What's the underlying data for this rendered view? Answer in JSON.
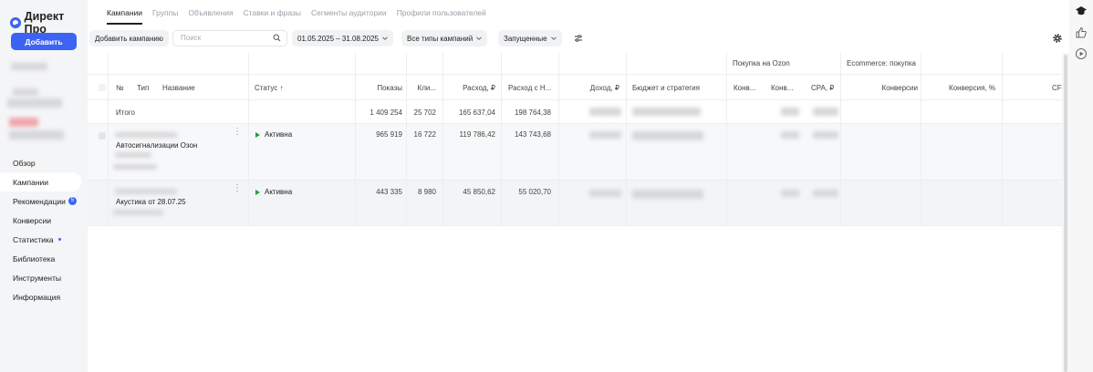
{
  "app": {
    "logo_text": "Директ Про",
    "add_button": "Добавить"
  },
  "sidebar": {
    "items": [
      {
        "label": "Обзор",
        "active": false
      },
      {
        "label": "Кампании",
        "active": true
      },
      {
        "label": "Рекомендации",
        "badge": "5"
      },
      {
        "label": "Конверсии"
      },
      {
        "label": "Статистика",
        "dot": true
      },
      {
        "label": "Библиотека"
      },
      {
        "label": "Инструменты"
      },
      {
        "label": "Информация"
      }
    ]
  },
  "tabs": [
    "Кампании",
    "Группы",
    "Объявления",
    "Ставки и фразы",
    "Сегменты аудитории",
    "Профили пользователей"
  ],
  "toolbar": {
    "add_campaign": "Добавить кампанию",
    "search_placeholder": "Поиск",
    "date_range": "01.05.2025 – 31.08.2025",
    "campaign_types": "Все типы кампаний",
    "state_filter": "Запущенные"
  },
  "table": {
    "group_headers": {
      "ozon": "Покупка на Ozon",
      "ecommerce": "Ecommerce: покупка"
    },
    "columns": {
      "num": "№",
      "type": "Тип",
      "name": "Название",
      "status": "Статус ↑",
      "impressions": "Показы",
      "clicks": "Кли...",
      "spend": "Расход, ₽",
      "spend_vat": "Расход с Н...",
      "income": "Доход, ₽",
      "budget": "Бюджет и стратегия",
      "ozon_conv": "Конв...",
      "ozon_conv2": "Конв...",
      "ozon_cpa": "CPA, ₽",
      "ecom_conv": "Конверсии",
      "ecom_conv_rate": "Конверсия, %",
      "ecom_cp": "CF"
    },
    "total": {
      "label": "Итого",
      "impressions": "1 409 254",
      "clicks": "25 702",
      "spend": "165 637,04",
      "spend_vat": "198 764,38"
    },
    "rows": [
      {
        "name": "Автосигнализации Озон",
        "status": "Активна",
        "impressions": "965 919",
        "clicks": "16 722",
        "spend": "119 786,42",
        "spend_vat": "143 743,68"
      },
      {
        "name": "Акустика от 28.07.25",
        "status": "Активна",
        "impressions": "443 335",
        "clicks": "8 980",
        "spend": "45 850,62",
        "spend_vat": "55 020,70"
      }
    ]
  },
  "icons": {
    "logo": "direct-logo-icon",
    "search": "search-icon",
    "chevron": "chevron-down-icon",
    "filters": "filter-sliders-icon",
    "settings": "gear-icon",
    "rail": [
      "graduation-cap-icon",
      "thumb-up-icon",
      "play-circle-icon"
    ]
  },
  "colors": {
    "accent": "#3d63f5",
    "active_status": "#22a046"
  }
}
